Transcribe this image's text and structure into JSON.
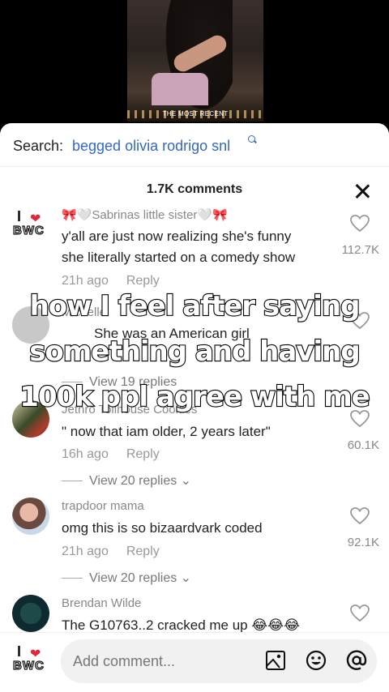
{
  "video": {
    "caption": "THE MOST RECENT"
  },
  "search": {
    "label": "Search:",
    "query": "begged olivia rodrigo snl"
  },
  "comments_header": {
    "title": "1.7K comments"
  },
  "comments": [
    {
      "username": "🎀🤍Sabrinas little sister🤍🎀",
      "lines": [
        "y'all are just now realizing she's funny",
        "she literally started on a comedy show"
      ],
      "time": "21h ago",
      "reply": "Reply",
      "likes": "112.7K"
    },
    {
      "username": "Michelle",
      "text": "She was an American girl",
      "time": "",
      "reply": "",
      "replies": "View 19 replies"
    },
    {
      "username": "Jethro Tollhouse Cookies",
      "text": "\" now that iam older, 2 years later\"",
      "time": "16h ago",
      "reply": "Reply",
      "likes": "60.1K",
      "replies": "View 20 replies"
    },
    {
      "username": "trapdoor mama",
      "text": "omg this is so bizaardvark coded",
      "time": "21h ago",
      "reply": "Reply",
      "likes": "92.1K",
      "replies": "View 20 replies"
    },
    {
      "username": "Brendan Wilde",
      "text": "The G10763..2 cracked me up 😂😂😂",
      "likes": ""
    }
  ],
  "overlay": {
    "lines": [
      "how I feel after saying",
      "something and having",
      "100k ppl agree with me"
    ]
  },
  "avatar_text": {
    "i": "I",
    "bwc": "BWC"
  },
  "composer": {
    "placeholder": "Add comment..."
  },
  "colors": {
    "link": "#3567c2",
    "heart": "#e0283a"
  }
}
